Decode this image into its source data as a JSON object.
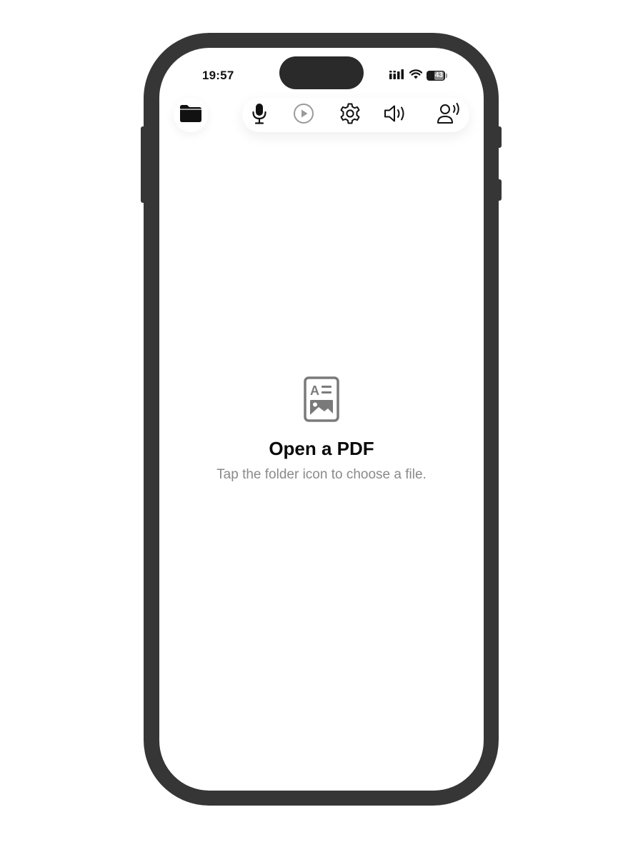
{
  "status_bar": {
    "time": "19:57",
    "battery_level": "43"
  },
  "toolbar": {
    "folder_icon": "folder-icon",
    "icons": [
      "microphone-icon",
      "play-icon",
      "gear-icon",
      "speaker-icon",
      "voice-person-icon"
    ],
    "play_state": "disabled"
  },
  "empty_state": {
    "icon": "document-image-icon",
    "title": "Open a PDF",
    "subtitle": "Tap the folder icon to choose a file."
  },
  "colors": {
    "frame": "#363636",
    "icon": "#111111",
    "disabled_icon": "#9a9a9a",
    "subtitle": "#8a8a8a"
  }
}
